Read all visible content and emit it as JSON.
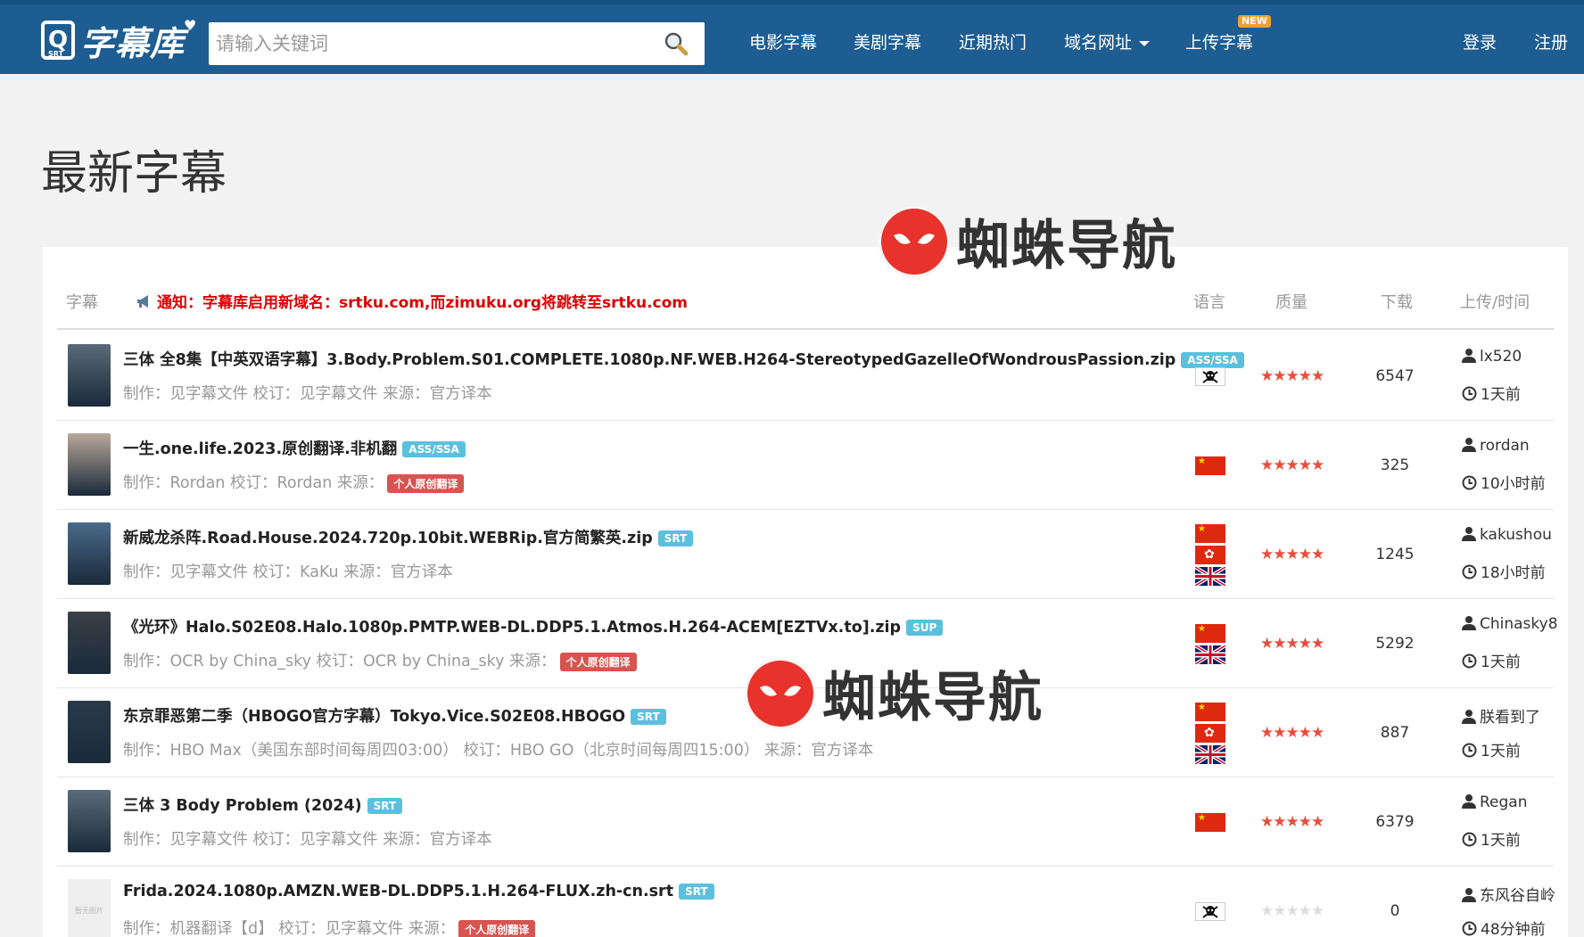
{
  "header": {
    "logo_text": "字幕库",
    "logo_mark": "Q",
    "logo_sub": "SRT",
    "search_placeholder": "请输入关键词",
    "nav": [
      "电影字幕",
      "美剧字幕",
      "近期热门",
      "域名网址",
      "上传字幕"
    ],
    "new_badge": "NEW",
    "login": "登录",
    "register": "注册"
  },
  "page_title": "最新字幕",
  "watermark_text": "蜘蛛导航",
  "table": {
    "headers": {
      "subtitle": "字幕",
      "language": "语言",
      "quality": "质量",
      "downloads": "下载",
      "uploader_time": "上传/时间"
    },
    "notice": "通知：字幕库启用新域名：srtku.com,而zimuku.org将跳转至srtku.com"
  },
  "rows": [
    {
      "title": "三体 全8集【中英双语字幕】3.Body.Problem.S01.COMPLETE.1080p.NF.WEB.H264-StereotypedGazelleOfWondrousPassion.zip",
      "format": "ASS/SSA",
      "meta": "制作：见字幕文件 校订：见字幕文件 来源：官方译本",
      "tag": "",
      "flags": [
        "pirate"
      ],
      "stars": "★★★★★",
      "rating": 5,
      "downloads": "6547",
      "user": "lx520",
      "time": "1天前",
      "thumb_color": "#5a6a78"
    },
    {
      "title": "一生.one.life.2023.原创翻译.非机翻",
      "format": "ASS/SSA",
      "meta": "制作：Rordan 校订：Rordan 来源：",
      "tag": "个人原创翻译",
      "flags": [
        "cn"
      ],
      "stars": "★★★★★",
      "rating": 5,
      "downloads": "325",
      "user": "rordan",
      "time": "10小时前",
      "thumb_color": "#b8a89a"
    },
    {
      "title": "新威龙杀阵.Road.House.2024.720p.10bit.WEBRip.官方简繁英.zip",
      "format": "SRT",
      "meta": "制作：见字幕文件 校订：KaKu 来源：官方译本",
      "tag": "",
      "flags": [
        "cn",
        "hk",
        "uk"
      ],
      "stars": "★★★★★",
      "rating": 5,
      "downloads": "1245",
      "user": "kakushou",
      "time": "18小时前",
      "thumb_color": "#4a6a8a"
    },
    {
      "title": "《光环》Halo.S02E08.Halo.1080p.PMTP.WEB-DL.DDP5.1.Atmos.H.264-ACEM[EZTVx.to].zip",
      "format": "SUP",
      "meta": "制作：OCR by China_sky 校订：OCR by China_sky 来源：",
      "tag": "个人原创翻译",
      "flags": [
        "cn",
        "uk"
      ],
      "stars": "★★★★★",
      "rating": 5,
      "downloads": "5292",
      "user": "Chinasky8",
      "time": "1天前",
      "thumb_color": "#3a4048"
    },
    {
      "title": "东京罪恶第二季（HBOGO官方字幕）Tokyo.Vice.S02E08.HBOGO",
      "format": "SRT",
      "meta": "制作：HBO Max（美国东部时间每周四03:00） 校订：HBO GO（北京时间每周四15:00） 来源：官方译本",
      "tag": "",
      "flags": [
        "cn",
        "hk",
        "uk"
      ],
      "stars": "★★★★★",
      "rating": 5,
      "downloads": "887",
      "user": "朕看到了",
      "time": "1天前",
      "thumb_color": "#2a3a4a"
    },
    {
      "title": "三体 3 Body Problem (2024)",
      "format": "SRT",
      "meta": "制作：见字幕文件 校订：见字幕文件 来源：官方译本",
      "tag": "",
      "flags": [
        "cn"
      ],
      "stars": "★★★★★",
      "rating": 5,
      "downloads": "6379",
      "user": "Regan",
      "time": "1天前",
      "thumb_color": "#5a6a78"
    },
    {
      "title": "Frida.2024.1080p.AMZN.WEB-DL.DDP5.1.H.264-FLUX.zh-cn.srt",
      "format": "SRT",
      "meta": "制作：机器翻译【d】 校订：见字幕文件 来源：",
      "tag": "个人原创翻译",
      "flags": [
        "pirate"
      ],
      "stars": "★★★★★",
      "rating": 0,
      "downloads": "0",
      "user": "东风谷自岭",
      "time": "48分钟前",
      "thumb_color": "#eeeeee",
      "thumb_text": "暂无图片"
    }
  ]
}
